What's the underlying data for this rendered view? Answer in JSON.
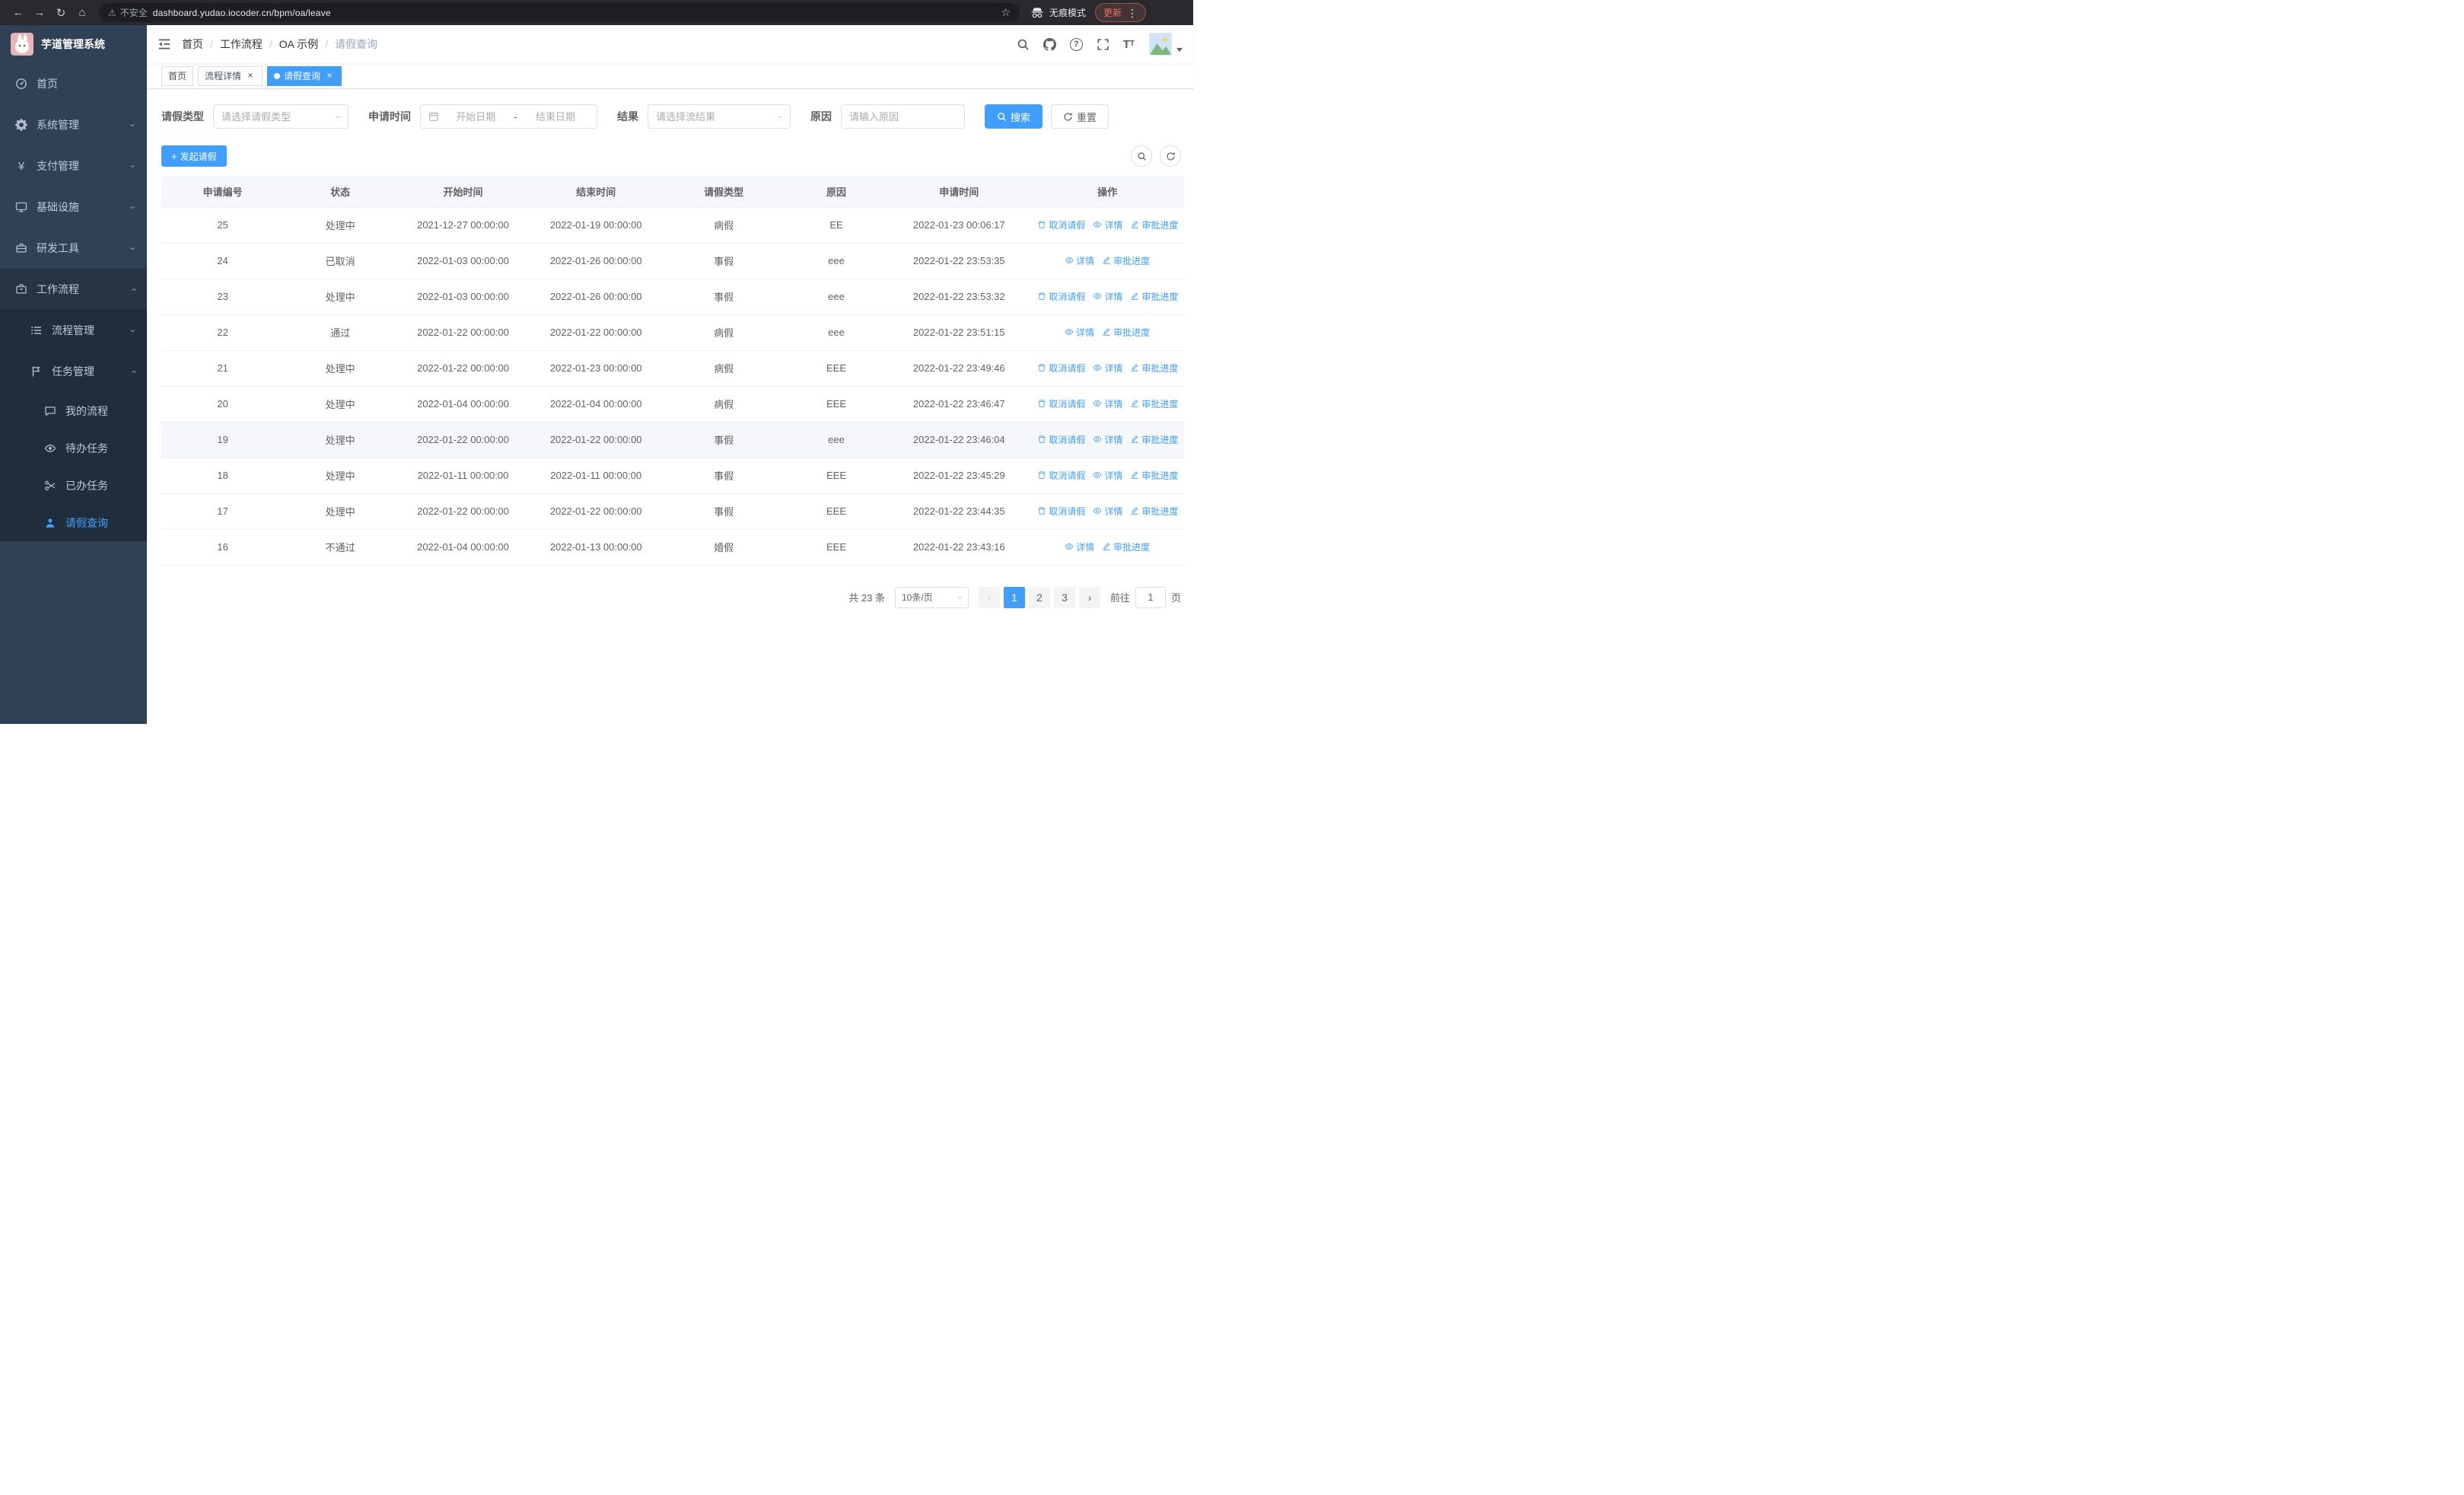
{
  "browser": {
    "security_label": "不安全",
    "url": "dashboard.yudao.iocoder.cn/bpm/oa/leave",
    "incognito_label": "无痕模式",
    "update_label": "更新"
  },
  "sidebar": {
    "app_title": "芋道管理系统",
    "items": [
      {
        "label": "首页"
      },
      {
        "label": "系统管理"
      },
      {
        "label": "支付管理"
      },
      {
        "label": "基础设施"
      },
      {
        "label": "研发工具"
      },
      {
        "label": "工作流程"
      }
    ],
    "workflow_children": [
      {
        "label": "流程管理"
      },
      {
        "label": "任务管理"
      }
    ],
    "task_children": [
      {
        "label": "我的流程"
      },
      {
        "label": "待办任务"
      },
      {
        "label": "已办任务"
      },
      {
        "label": "请假查询"
      }
    ]
  },
  "header": {
    "breadcrumb": [
      "首页",
      "工作流程",
      "OA 示例",
      "请假查询"
    ]
  },
  "tabs": {
    "items": [
      {
        "label": "首页"
      },
      {
        "label": "流程详情"
      },
      {
        "label": "请假查询"
      }
    ]
  },
  "filters": {
    "leave_type_label": "请假类型",
    "leave_type_placeholder": "请选择请假类型",
    "apply_time_label": "申请时间",
    "date_start_placeholder": "开始日期",
    "date_separator": "-",
    "date_end_placeholder": "结束日期",
    "result_label": "结果",
    "result_placeholder": "请选择流结果",
    "reason_label": "原因",
    "reason_placeholder": "请输入原因",
    "search_label": "搜索",
    "reset_label": "重置"
  },
  "toolbar": {
    "create_label": "发起请假"
  },
  "table": {
    "columns": [
      "申请编号",
      "状态",
      "开始时间",
      "结束时间",
      "请假类型",
      "原因",
      "申请时间",
      "操作"
    ],
    "action_labels": {
      "cancel": "取消请假",
      "detail": "详情",
      "progress": "审批进度"
    },
    "rows": [
      {
        "id": "25",
        "status": "处理中",
        "start_time": "2021-12-27 00:00:00",
        "end_time": "2022-01-19 00:00:00",
        "leave_type": "病假",
        "reason": "EE",
        "apply_time": "2022-01-23 00:06:17",
        "actions": [
          "cancel",
          "detail",
          "progress"
        ]
      },
      {
        "id": "24",
        "status": "已取消",
        "start_time": "2022-01-03 00:00:00",
        "end_time": "2022-01-26 00:00:00",
        "leave_type": "事假",
        "reason": "eee",
        "apply_time": "2022-01-22 23:53:35",
        "actions": [
          "detail",
          "progress"
        ]
      },
      {
        "id": "23",
        "status": "处理中",
        "start_time": "2022-01-03 00:00:00",
        "end_time": "2022-01-26 00:00:00",
        "leave_type": "事假",
        "reason": "eee",
        "apply_time": "2022-01-22 23:53:32",
        "actions": [
          "cancel",
          "detail",
          "progress"
        ]
      },
      {
        "id": "22",
        "status": "通过",
        "start_time": "2022-01-22 00:00:00",
        "end_time": "2022-01-22 00:00:00",
        "leave_type": "病假",
        "reason": "eee",
        "apply_time": "2022-01-22 23:51:15",
        "actions": [
          "detail",
          "progress"
        ]
      },
      {
        "id": "21",
        "status": "处理中",
        "start_time": "2022-01-22 00:00:00",
        "end_time": "2022-01-23 00:00:00",
        "leave_type": "病假",
        "reason": "EEE",
        "apply_time": "2022-01-22 23:49:46",
        "actions": [
          "cancel",
          "detail",
          "progress"
        ]
      },
      {
        "id": "20",
        "status": "处理中",
        "start_time": "2022-01-04 00:00:00",
        "end_time": "2022-01-04 00:00:00",
        "leave_type": "病假",
        "reason": "EEE",
        "apply_time": "2022-01-22 23:46:47",
        "actions": [
          "cancel",
          "detail",
          "progress"
        ]
      },
      {
        "id": "19",
        "status": "处理中",
        "start_time": "2022-01-22 00:00:00",
        "end_time": "2022-01-22 00:00:00",
        "leave_type": "事假",
        "reason": "eee",
        "apply_time": "2022-01-22 23:46:04",
        "actions": [
          "cancel",
          "detail",
          "progress"
        ],
        "hovered": true
      },
      {
        "id": "18",
        "status": "处理中",
        "start_time": "2022-01-11 00:00:00",
        "end_time": "2022-01-11 00:00:00",
        "leave_type": "事假",
        "reason": "EEE",
        "apply_time": "2022-01-22 23:45:29",
        "actions": [
          "cancel",
          "detail",
          "progress"
        ]
      },
      {
        "id": "17",
        "status": "处理中",
        "start_time": "2022-01-22 00:00:00",
        "end_time": "2022-01-22 00:00:00",
        "leave_type": "事假",
        "reason": "EEE",
        "apply_time": "2022-01-22 23:44:35",
        "actions": [
          "cancel",
          "detail",
          "progress"
        ]
      },
      {
        "id": "16",
        "status": "不通过",
        "start_time": "2022-01-04 00:00:00",
        "end_time": "2022-01-13 00:00:00",
        "leave_type": "婚假",
        "reason": "EEE",
        "apply_time": "2022-01-22 23:43:16",
        "actions": [
          "detail",
          "progress"
        ]
      }
    ]
  },
  "pagination": {
    "total_label": "共 23 条",
    "page_size_label": "10条/页",
    "pages": [
      "1",
      "2",
      "3"
    ],
    "active_page": "1",
    "goto_label": "前往",
    "goto_value": "1",
    "page_unit": "页"
  }
}
